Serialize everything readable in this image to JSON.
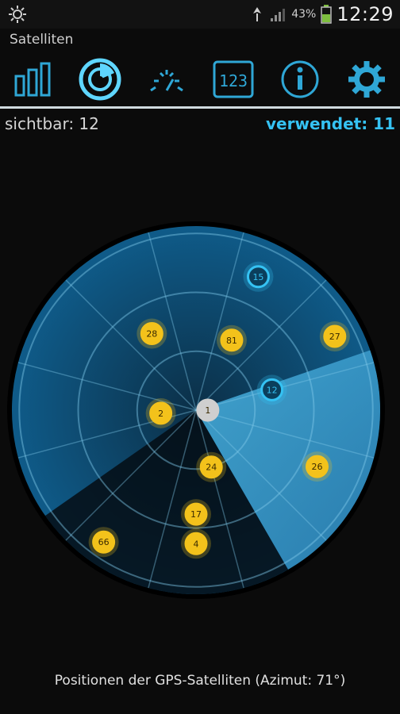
{
  "status": {
    "battery": "43%",
    "time": "12:29",
    "icons": [
      "settings-gear-icon",
      "signal-icon",
      "battery-icon"
    ]
  },
  "app": {
    "title": "Satelliten"
  },
  "toolbar": {
    "items": [
      {
        "name": "signal-strength",
        "icon": "bars-icon"
      },
      {
        "name": "radar",
        "icon": "radar-icon",
        "active": true
      },
      {
        "name": "speed",
        "icon": "speedometer-icon"
      },
      {
        "name": "numbers",
        "icon": "digital-display-icon",
        "text": "123"
      },
      {
        "name": "info",
        "icon": "info-icon"
      },
      {
        "name": "settings",
        "icon": "gear-icon"
      }
    ]
  },
  "counts": {
    "visible": "sichtbar: 12",
    "used": "verwendet: 11"
  },
  "radar": {
    "satellites": [
      {
        "id": "15",
        "az": 25,
        "el": 15,
        "color": "blue"
      },
      {
        "id": "28",
        "az": 330,
        "el": 45,
        "color": "yellow"
      },
      {
        "id": "27",
        "az": 62,
        "el": 10,
        "color": "yellow"
      },
      {
        "id": "81",
        "az": 27,
        "el": 50,
        "color": "yellow"
      },
      {
        "id": "12",
        "az": 75,
        "el": 50,
        "color": "blue"
      },
      {
        "id": "1",
        "az": 90,
        "el": 84,
        "color": "gray"
      },
      {
        "id": "2",
        "az": 265,
        "el": 72,
        "color": "yellow"
      },
      {
        "id": "24",
        "az": 165,
        "el": 60,
        "color": "yellow"
      },
      {
        "id": "26",
        "az": 115,
        "el": 22,
        "color": "yellow"
      },
      {
        "id": "17",
        "az": 180,
        "el": 37,
        "color": "yellow"
      },
      {
        "id": "4",
        "az": 180,
        "el": 22,
        "color": "yellow"
      },
      {
        "id": "66",
        "az": 215,
        "el": 8,
        "color": "yellow"
      }
    ],
    "colors": {
      "blue": "#35c2f3",
      "yellow": "#f3c21b",
      "gray": "#cfcfcf",
      "disc": "#0f4f77",
      "sector": "#3fa0d0"
    }
  },
  "caption": "Positionen der GPS-Satelliten (Azimut: 71°)"
}
